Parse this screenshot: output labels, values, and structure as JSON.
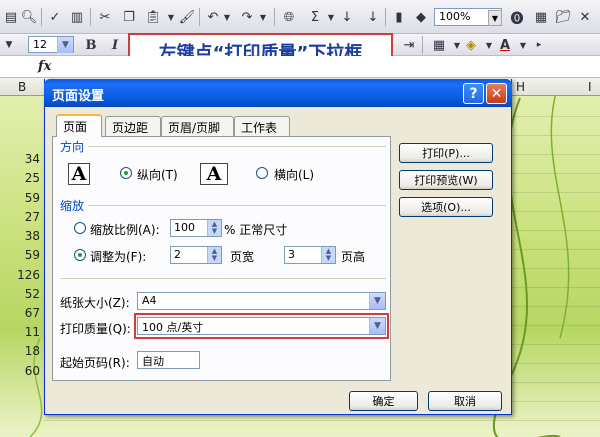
{
  "toolbar": {
    "zoom": "100%",
    "font_size": "12",
    "bold_label": "B",
    "italic_label": "I"
  },
  "callout": {
    "text": "左键点“打印质量”下拉框"
  },
  "formula_bar": {
    "fx_label": "fx"
  },
  "sheet": {
    "col_letters": [
      "B",
      "H",
      "I"
    ],
    "row_values": [
      "34",
      "25",
      "59",
      "27",
      "38",
      "59",
      "126",
      "52",
      "67",
      "11",
      "18",
      "60"
    ]
  },
  "dialog": {
    "title": "页面设置",
    "help_label": "?",
    "close_label": "✕",
    "tabs": [
      "页面",
      "页边距",
      "页眉/页脚",
      "工作表"
    ],
    "orientation": {
      "group_label": "方向",
      "portrait_label": "纵向(T)",
      "landscape_label": "横向(L)",
      "glyph": "A"
    },
    "scaling": {
      "group_label": "缩放",
      "adjust_label": "缩放比例(A):",
      "adjust_value": "100",
      "adjust_suffix": "% 正常尺寸",
      "fit_label": "调整为(F):",
      "fit_wide_value": "2",
      "fit_wide_suffix": "页宽",
      "fit_tall_value": "3",
      "fit_tall_suffix": "页高"
    },
    "paper_size": {
      "label": "纸张大小(Z):",
      "value": "A4"
    },
    "print_quality": {
      "label": "打印质量(Q):",
      "value": "100 点/英寸"
    },
    "first_page": {
      "label": "起始页码(R):",
      "value": "自动"
    },
    "side_buttons": [
      "打印(P)...",
      "打印预览(W)",
      "选项(O)..."
    ],
    "ok_label": "确定",
    "cancel_label": "取消"
  }
}
